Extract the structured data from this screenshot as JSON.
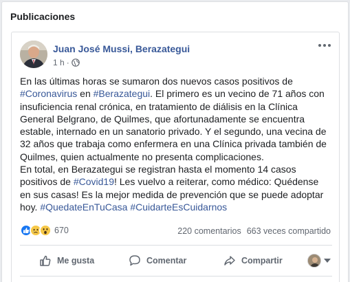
{
  "panel": {
    "title": "Publicaciones"
  },
  "post": {
    "author": "Juan José Mussi, Berazategui",
    "time": "1 h",
    "time_separator": "·",
    "audience_icon": "globe-icon",
    "body": {
      "l1a": "En las últimas horas se sumaron dos nuevos casos positivos de",
      "l2tag1": "#Coronavirus",
      "l2a": " en ",
      "l2tag2": "#Berazategui",
      "l2b": ". El primero es un vecino de 71 años con",
      "l3": "insuficiencia renal crónica, en tratamiento de diálisis en la Clínica",
      "l4": "General Belgrano, de Quilmes, que afortunadamente se encuentra",
      "l5": "estable, internado en un sanatorio privado. Y el segundo, una vecina de",
      "l6": "32 años que trabaja como enfermera en una Clínica privada también de",
      "l7": "Quilmes, quien actualmente no presenta complicaciones.",
      "l8": "En total, en Berazategui se registran hasta el momento 14 casos",
      "l9a": "positivos de ",
      "l9tag": "#Covid19",
      "l9b": "! Les vuelvo a reiterar, como médico: Quédense",
      "l10": "en sus casas! Es la mejor medida de prevención que se puede adoptar",
      "l11a": "hoy. ",
      "l11tag1": "#QuedateEnTuCasa",
      "l11sp": " ",
      "l11tag2": "#CuidarteEsCuidarnos"
    },
    "reactions": {
      "icons": [
        "like-icon",
        "sad-icon",
        "wow-icon"
      ],
      "count": "670"
    },
    "comments": "220 comentarios",
    "shares": "663 veces compartido",
    "actions": {
      "like": "Me gusta",
      "comment": "Comentar",
      "share": "Compartir"
    }
  }
}
